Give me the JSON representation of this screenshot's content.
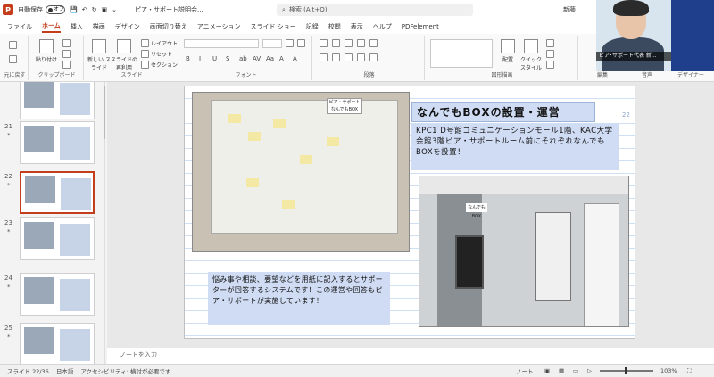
{
  "titlebar": {
    "autosave_label": "自動保存",
    "autosave_state": "オフ",
    "doc_title": "ピア・サポート説明会...",
    "search_placeholder": "検索 (Alt+Q)",
    "user_name": "新藤"
  },
  "menu": {
    "tabs": [
      "ファイル",
      "ホーム",
      "挿入",
      "描画",
      "デザイン",
      "画面切り替え",
      "アニメーション",
      "スライド ショー",
      "記録",
      "校閲",
      "表示",
      "ヘルプ",
      "PDFelement"
    ],
    "active_index": 1
  },
  "ribbon": {
    "clipboard": {
      "label": "クリップボード",
      "paste": "貼り付け"
    },
    "slides": {
      "label": "スライド",
      "new_slide": "新しい スライド",
      "reuse": "スライドの 再利用",
      "layout": "レイアウト",
      "reset": "リセット",
      "section": "セクション"
    },
    "font": {
      "label": "フォント"
    },
    "paragraph": {
      "label": "段落"
    },
    "drawing": {
      "label": "図形描画",
      "arrange": "配置",
      "quick_style": "クイック スタイル"
    },
    "editing": {
      "label": "編集"
    },
    "voice": {
      "label": "音声"
    },
    "designer": {
      "label": "デザイナー"
    },
    "format_buttons": [
      "B",
      "I",
      "U",
      "S",
      "ab",
      "AV",
      "Aa",
      "A",
      "A"
    ],
    "undo_label": "元に戻す"
  },
  "video": {
    "caption": "ピア･サポート代表 新..."
  },
  "thumbnails": [
    {
      "num": "21",
      "star": "*"
    },
    {
      "num": "22",
      "star": "*",
      "selected": true
    },
    {
      "num": "23",
      "star": "*"
    },
    {
      "num": "24",
      "star": "*"
    },
    {
      "num": "25",
      "star": "*"
    }
  ],
  "slide": {
    "title": "なんでもBOXの設置・運営",
    "body_top": "KPC1 D号館コミュニケーションモール1階、KAC大学会館3階ピア・サポートルーム前にそれぞれなんでもBOXを設置！",
    "body_bottom": "悩み事や相談、要望などを用紙に記入するとサポーターが回答するシステムです！この運営や回答もピア・サポートが実施しています！",
    "slide_number": "22",
    "photo_board_text": "ピア・サポート なんでもBOX",
    "photo_box_label": "なんでもBOX"
  },
  "notes": {
    "placeholder": "ノートを入力"
  },
  "status": {
    "slide_counter": "スライド 22/36",
    "language": "日本語",
    "accessibility": "アクセシビリティ: 検討が必要です",
    "notes_button": "ノート",
    "zoom_percent": "103%"
  },
  "colors": {
    "accent": "#c43e1c",
    "text_box": "#cfdcf3"
  }
}
